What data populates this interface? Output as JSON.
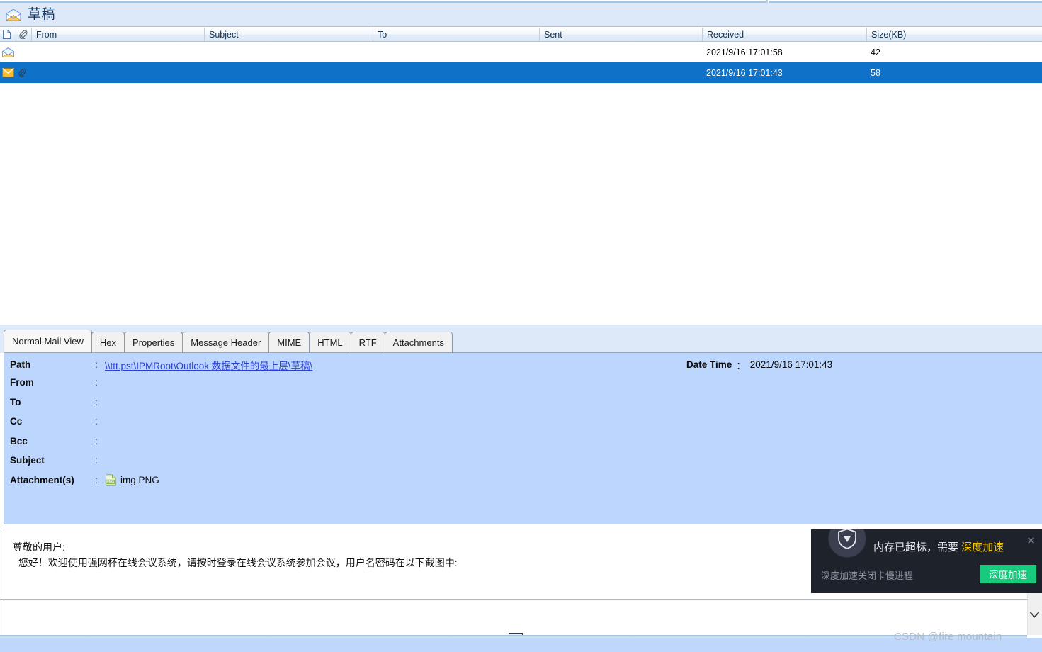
{
  "folder": {
    "icon": "open-envelope-icon",
    "title": "草稿"
  },
  "list": {
    "columns": [
      {
        "key": "doc",
        "label": "",
        "icon": "document-icon"
      },
      {
        "key": "clip",
        "label": "",
        "icon": "paperclip-icon"
      },
      {
        "key": "from",
        "label": "From"
      },
      {
        "key": "subject",
        "label": "Subject"
      },
      {
        "key": "to",
        "label": "To"
      },
      {
        "key": "sent",
        "label": "Sent"
      },
      {
        "key": "received",
        "label": "Received"
      },
      {
        "key": "size",
        "label": "Size(KB)"
      }
    ],
    "rows": [
      {
        "icon": "open-envelope-icon",
        "attachment_icon": "",
        "from": "",
        "subject": "",
        "to": "",
        "sent": "",
        "received": "2021/9/16 17:01:58",
        "size": "42",
        "selected": false
      },
      {
        "icon": "closed-envelope-icon",
        "attachment_icon": "paperclip-icon",
        "from": "",
        "subject": "",
        "to": "",
        "sent": "",
        "received": "2021/9/16 17:01:43",
        "size": "58",
        "selected": true
      }
    ]
  },
  "tabs": [
    {
      "label": "Normal Mail View",
      "active": true
    },
    {
      "label": "Hex",
      "active": false
    },
    {
      "label": "Properties",
      "active": false
    },
    {
      "label": "Message Header",
      "active": false
    },
    {
      "label": "MIME",
      "active": false
    },
    {
      "label": "HTML",
      "active": false
    },
    {
      "label": "RTF",
      "active": false
    },
    {
      "label": "Attachments",
      "active": false
    }
  ],
  "details": {
    "colon": ":",
    "fields": [
      {
        "label": "Path",
        "value": "\\\\ttt.pst\\IPMRoot\\Outlook 数据文件的最上层\\草稿\\",
        "is_link": true
      },
      {
        "label": "From",
        "value": "",
        "is_link": false
      },
      {
        "label": "To",
        "value": "",
        "is_link": false
      },
      {
        "label": "Cc",
        "value": "",
        "is_link": false
      },
      {
        "label": "Bcc",
        "value": "",
        "is_link": false
      },
      {
        "label": "Subject",
        "value": "",
        "is_link": false
      }
    ],
    "attachment": {
      "label": "Attachment(s)",
      "icon": "png-file-icon",
      "filename": "img.PNG"
    },
    "date_time": {
      "label": "Date Time",
      "colon": "：",
      "value": "2021/9/16 17:01:43"
    }
  },
  "body": {
    "text": "尊敬的用户:\n  您好！欢迎使用强网杯在线会议系统，请按时登录在线会议系统参加会议，用户名密码在以下截图中:"
  },
  "toast": {
    "badge_icon": "shield-icon",
    "title_prefix": "内存已超标，需要 ",
    "title_highlight": "深度加速",
    "subtitle": "深度加速关闭卡慢进程",
    "button_label": "深度加速",
    "close_icon": "close-icon",
    "accent_color": "#18c97e",
    "highlight_color": "#f2c300"
  },
  "scrollbar": {
    "down_icon": "chevron-down-icon"
  },
  "watermark": {
    "text": "CSDN @fire mountain"
  }
}
